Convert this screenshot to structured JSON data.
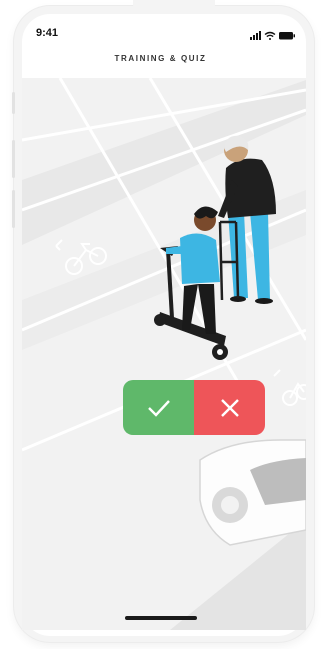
{
  "status_bar": {
    "time": "9:41"
  },
  "header": {
    "title": "TRAINING & QUIZ"
  },
  "answers": {
    "yes_icon": "check-icon",
    "no_icon": "close-icon"
  },
  "colors": {
    "yes": "#5fb86a",
    "no": "#ee5559",
    "shirt": "#3db6e3"
  }
}
